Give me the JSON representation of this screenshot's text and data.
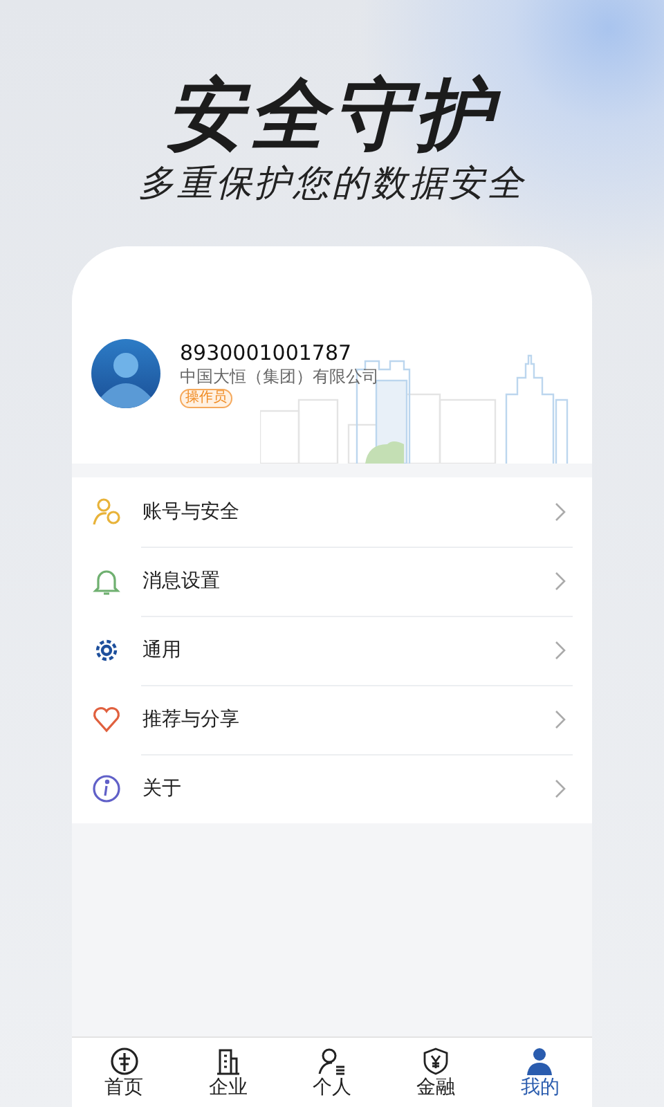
{
  "headline": "安全守护",
  "subtitle": "多重保护您的数据安全",
  "profile": {
    "account": "8930001001787",
    "company": "中国大恒（集团）有限公司",
    "role": "操作员"
  },
  "menu": [
    {
      "kind": "account",
      "label": "账号与安全"
    },
    {
      "kind": "bell",
      "label": "消息设置"
    },
    {
      "kind": "gear",
      "label": "通用"
    },
    {
      "kind": "heart",
      "label": "推荐与分享"
    },
    {
      "kind": "info",
      "label": "关于"
    }
  ],
  "tabs": [
    {
      "kind": "home",
      "label": "首页",
      "selected": false
    },
    {
      "kind": "building",
      "label": "企业",
      "selected": false
    },
    {
      "kind": "person",
      "label": "个人",
      "selected": false
    },
    {
      "kind": "shield",
      "label": "金融",
      "selected": false
    },
    {
      "kind": "me",
      "label": "我的",
      "selected": true
    }
  ]
}
